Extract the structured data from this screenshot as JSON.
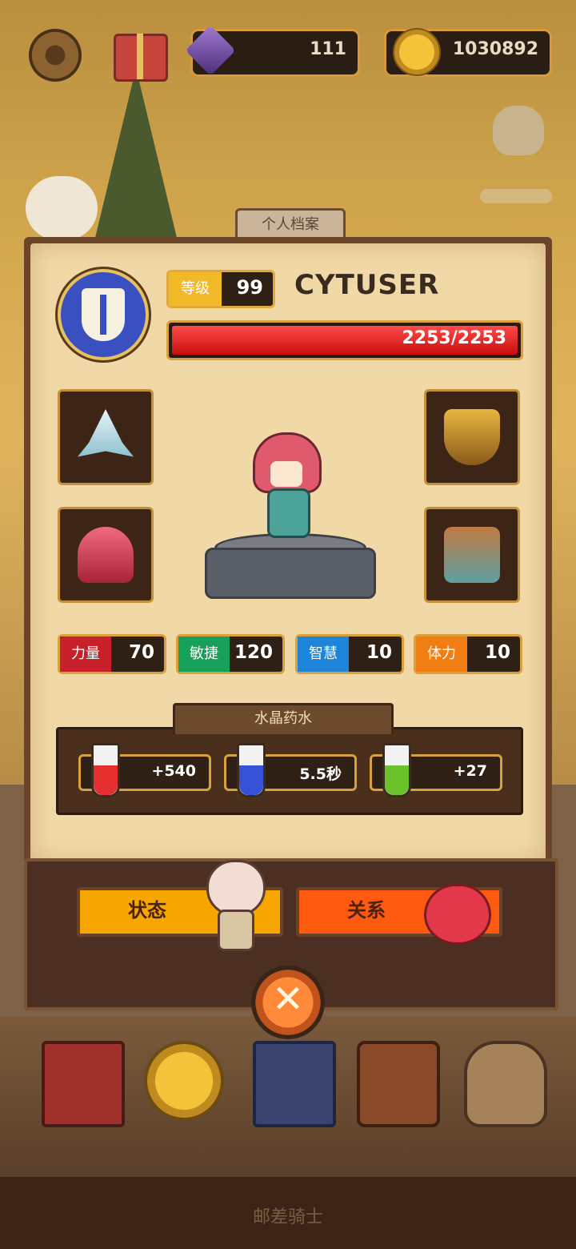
{
  "hud": {
    "gems": "111",
    "gold": "1030892"
  },
  "profile": {
    "tab_title": "个人档案",
    "level_label": "等级",
    "level": "99",
    "name": "CYTUSER",
    "hp_text": "2253/2253",
    "hp_fraction": 1.0
  },
  "stats": [
    {
      "label": "力量",
      "value": "70",
      "color": "#c8202a"
    },
    {
      "label": "敏捷",
      "value": "120",
      "color": "#17a05a"
    },
    {
      "label": "智慧",
      "value": "10",
      "color": "#1d84d9"
    },
    {
      "label": "体力",
      "value": "10",
      "color": "#f07e12"
    }
  ],
  "potions": {
    "title": "水晶药水",
    "items": [
      {
        "value": "+540",
        "icon": "red-hp-potion-icon",
        "color": "#e63030"
      },
      {
        "value": "5.5秒",
        "icon": "blue-hourglass-potion-icon",
        "color": "#3650d8"
      },
      {
        "value": "+27",
        "icon": "green-sword-potion-icon",
        "color": "#6cc22a"
      }
    ]
  },
  "buttons": {
    "status": "状态",
    "relations": "关系",
    "close": "✕"
  },
  "footer": {
    "title": "邮差骑士"
  },
  "colors": {
    "status_button": "#f7a600",
    "relations_button": "#ff5a10",
    "hp_bar": "#e01818"
  }
}
